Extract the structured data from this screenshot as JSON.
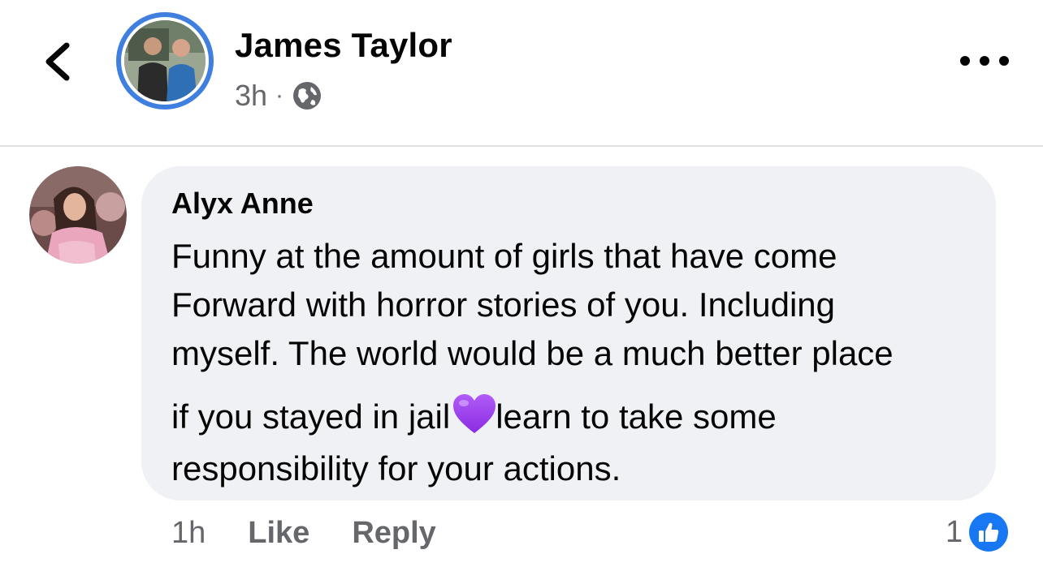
{
  "post": {
    "author_name": "James Taylor",
    "time": "3h",
    "separator": "·",
    "audience_icon": "globe-icon"
  },
  "comment": {
    "author_name": "Alyx Anne",
    "lines": [
      "Funny at the amount of girls that have come",
      "Forward with horror stories of you. Including",
      "myself. The world would be a much better place",
      "if you stayed in jail",
      "learn to take some",
      "responsibility for your actions."
    ],
    "emoji": "purple-heart-icon",
    "time": "1h",
    "like_label": "Like",
    "reply_label": "Reply",
    "reaction_count": "1",
    "reaction_icon": "thumbs-up-icon"
  },
  "colors": {
    "accent_blue": "#1877f2",
    "avatar_ring": "#3f7fe0",
    "bubble_bg": "#f0f1f4",
    "secondary_text": "#65676b",
    "heart": "#9b3ff0"
  }
}
